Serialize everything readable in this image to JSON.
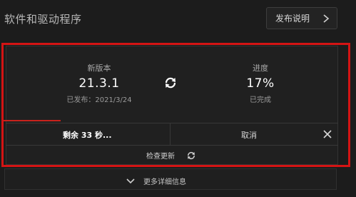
{
  "section": {
    "title": "软件和驱动程序",
    "release_notes_label": "发布说明"
  },
  "update": {
    "version_label": "新版本",
    "version": "21.3.1",
    "released": "已发布：2021/3/24",
    "progress_label": "进度",
    "progress": "17%",
    "progress_status": "已完成",
    "remaining": "剩余 33 秒...",
    "cancel_label": "取消",
    "check_label": "检查更新"
  },
  "footer": {
    "more_info_label": "更多详细信息"
  },
  "colors": {
    "highlight": "#d41414",
    "background": "#1c1c1c"
  }
}
